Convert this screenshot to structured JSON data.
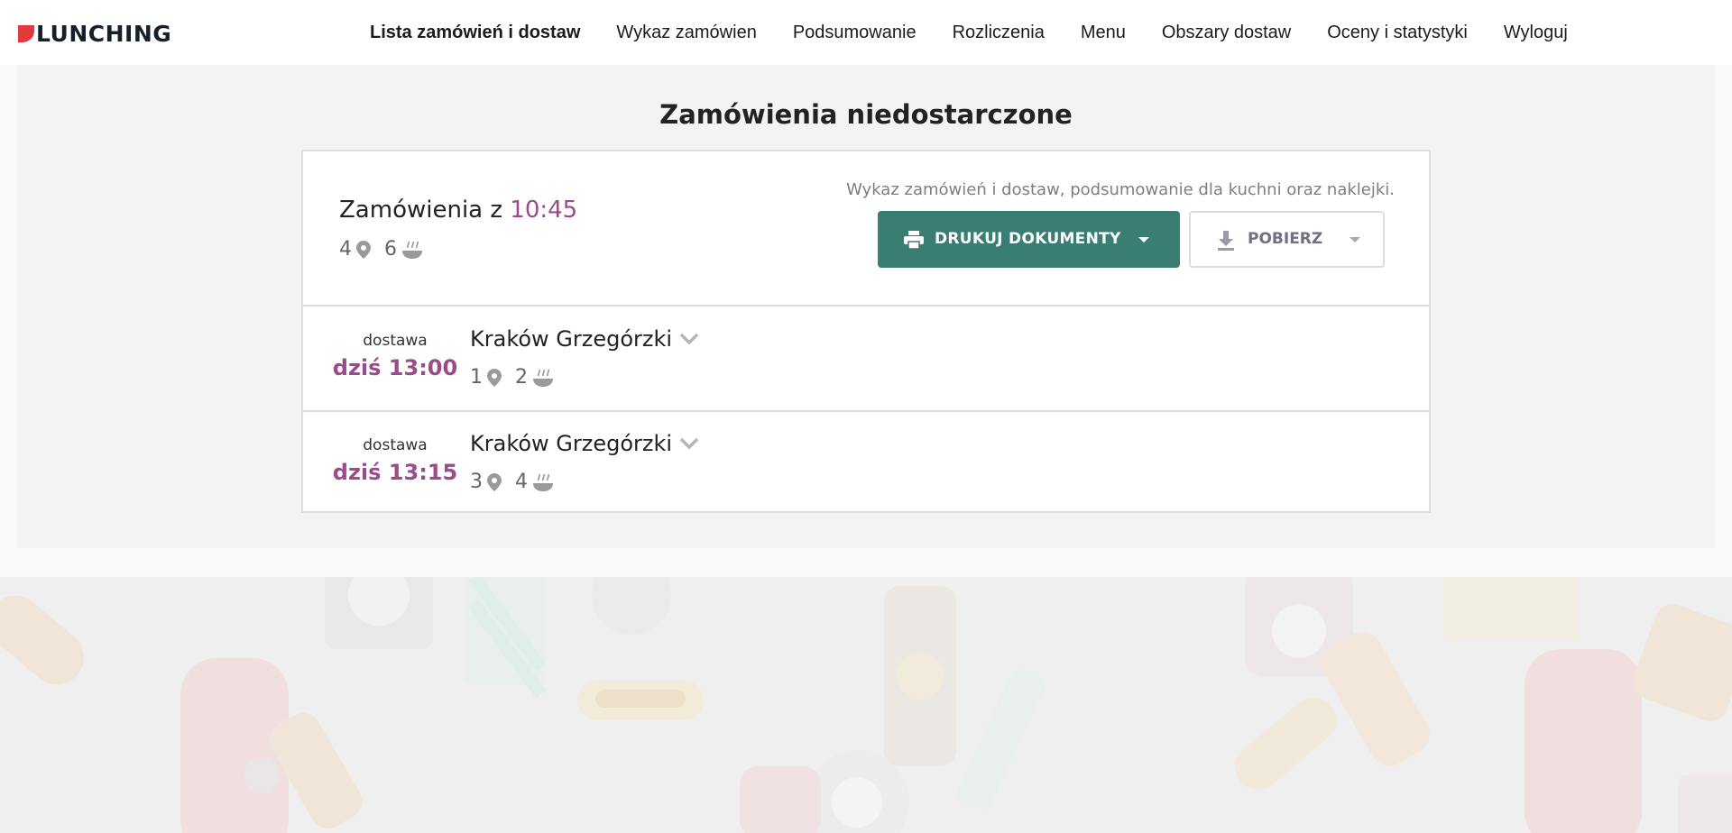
{
  "brand": {
    "name": "LUNCHING",
    "accent": "#e03a3e"
  },
  "nav": {
    "items": [
      {
        "label": "Lista zamówień i dostaw",
        "active": true
      },
      {
        "label": "Wykaz zamówien",
        "active": false
      },
      {
        "label": "Podsumowanie",
        "active": false
      },
      {
        "label": "Rozliczenia",
        "active": false
      },
      {
        "label": "Menu",
        "active": false
      },
      {
        "label": "Obszary dostaw",
        "active": false
      },
      {
        "label": "Oceny i statystyki",
        "active": false
      },
      {
        "label": "Wyloguj",
        "active": false
      }
    ]
  },
  "section": {
    "title": "Zamówienia niedostarczone"
  },
  "batch": {
    "title_prefix": "Zamówienia z",
    "time": "10:45",
    "locations": "4",
    "meals": "6",
    "hint": "Wykaz zamówień i dostaw, podsumowanie dla kuchni oraz naklejki.",
    "print_label": "DRUKUJ DOKUMENTY",
    "download_label": "POBIERZ"
  },
  "deliveries": [
    {
      "label": "dostawa",
      "time": "dziś 13:00",
      "area": "Kraków Grzegórzki",
      "locations": "1",
      "meals": "2"
    },
    {
      "label": "dostawa",
      "time": "dziś 13:15",
      "area": "Kraków Grzegórzki",
      "locations": "3",
      "meals": "4"
    }
  ],
  "colors": {
    "primary": "#3a7d72",
    "time_accent": "#9c4a8a"
  },
  "icons": [
    "map-pin-icon",
    "soup-bowl-icon",
    "printer-icon",
    "download-icon",
    "chevron-down-icon",
    "caret-down-icon"
  ]
}
